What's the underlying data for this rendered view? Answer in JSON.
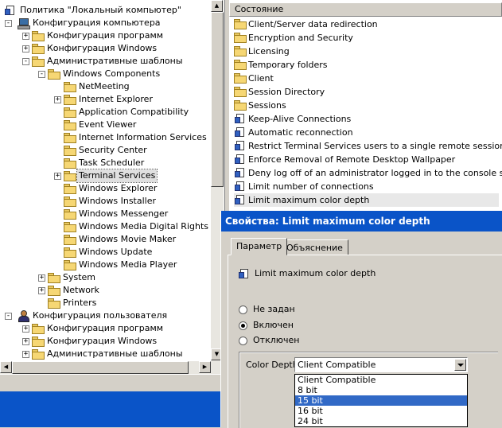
{
  "tree": {
    "items": [
      {
        "label": "Политика \"Локальный компьютер\"",
        "level": 0,
        "expander": "",
        "icon": "policy"
      },
      {
        "label": "Конфигурация компьютера",
        "level": 0,
        "expander": "−",
        "icon": "computer"
      },
      {
        "label": "Конфигурация программ",
        "level": 1,
        "expander": "+",
        "icon": "folder"
      },
      {
        "label": "Конфигурация Windows",
        "level": 1,
        "expander": "+",
        "icon": "folder"
      },
      {
        "label": "Административные шаблоны",
        "level": 1,
        "expander": "−",
        "icon": "folder"
      },
      {
        "label": "Windows Components",
        "level": 2,
        "expander": "−",
        "icon": "folder"
      },
      {
        "label": "NetMeeting",
        "level": 3,
        "expander": "",
        "icon": "folder"
      },
      {
        "label": "Internet Explorer",
        "level": 3,
        "expander": "+",
        "icon": "folder"
      },
      {
        "label": "Application Compatibility",
        "level": 3,
        "expander": "",
        "icon": "folder"
      },
      {
        "label": "Event Viewer",
        "level": 3,
        "expander": "",
        "icon": "folder"
      },
      {
        "label": "Internet Information Services",
        "level": 3,
        "expander": "",
        "icon": "folder"
      },
      {
        "label": "Security Center",
        "level": 3,
        "expander": "",
        "icon": "folder"
      },
      {
        "label": "Task Scheduler",
        "level": 3,
        "expander": "",
        "icon": "folder"
      },
      {
        "label": "Terminal Services",
        "level": 3,
        "expander": "+",
        "icon": "folder",
        "selected": true
      },
      {
        "label": "Windows Explorer",
        "level": 3,
        "expander": "",
        "icon": "folder"
      },
      {
        "label": "Windows Installer",
        "level": 3,
        "expander": "",
        "icon": "folder"
      },
      {
        "label": "Windows Messenger",
        "level": 3,
        "expander": "",
        "icon": "folder"
      },
      {
        "label": "Windows Media Digital Rights Mana",
        "level": 3,
        "expander": "",
        "icon": "folder"
      },
      {
        "label": "Windows Movie Maker",
        "level": 3,
        "expander": "",
        "icon": "folder"
      },
      {
        "label": "Windows Update",
        "level": 3,
        "expander": "",
        "icon": "folder"
      },
      {
        "label": "Windows Media Player",
        "level": 3,
        "expander": "",
        "icon": "folder"
      },
      {
        "label": "System",
        "level": 2,
        "expander": "+",
        "icon": "folder"
      },
      {
        "label": "Network",
        "level": 2,
        "expander": "+",
        "icon": "folder"
      },
      {
        "label": "Printers",
        "level": 2,
        "expander": "",
        "icon": "folder"
      },
      {
        "label": "Конфигурация пользователя",
        "level": 0,
        "expander": "−",
        "icon": "user"
      },
      {
        "label": "Конфигурация программ",
        "level": 1,
        "expander": "+",
        "icon": "folder"
      },
      {
        "label": "Конфигурация Windows",
        "level": 1,
        "expander": "+",
        "icon": "folder"
      },
      {
        "label": "Административные шаблоны",
        "level": 1,
        "expander": "+",
        "icon": "folder"
      }
    ]
  },
  "list": {
    "header": "Состояние",
    "items": [
      {
        "label": "Client/Server data redirection",
        "icon": "folder"
      },
      {
        "label": "Encryption and Security",
        "icon": "folder"
      },
      {
        "label": "Licensing",
        "icon": "folder"
      },
      {
        "label": "Temporary folders",
        "icon": "folder"
      },
      {
        "label": "Client",
        "icon": "folder"
      },
      {
        "label": "Session Directory",
        "icon": "folder"
      },
      {
        "label": "Sessions",
        "icon": "folder"
      },
      {
        "label": "Keep-Alive Connections",
        "icon": "policy"
      },
      {
        "label": "Automatic reconnection",
        "icon": "policy"
      },
      {
        "label": "Restrict Terminal Services users to a single remote session",
        "icon": "policy"
      },
      {
        "label": "Enforce Removal of Remote Desktop Wallpaper",
        "icon": "policy"
      },
      {
        "label": "Deny log off of an administrator logged in to the console session",
        "icon": "policy"
      },
      {
        "label": "Limit number of connections",
        "icon": "policy"
      },
      {
        "label": "Limit maximum color depth",
        "icon": "policy",
        "selected": true
      }
    ]
  },
  "dialog": {
    "title": "Свойства: Limit maximum color depth",
    "tabs": [
      "Параметр",
      "Объяснение"
    ],
    "setting_name": "Limit maximum color depth",
    "radios": [
      {
        "label": "Не задан",
        "checked": false
      },
      {
        "label": "Включен",
        "checked": true
      },
      {
        "label": "Отключен",
        "checked": false
      }
    ],
    "color_depth_label": "Color Depth",
    "color_depth_value": "Client Compatible",
    "options": [
      "Client Compatible",
      "8 bit",
      "15 bit",
      "16 bit",
      "24 bit"
    ],
    "highlighted_option": "15 bit"
  },
  "colors": {
    "titlebar": "#0a54c8",
    "selection": "#3169c6",
    "face": "#d4d0c8"
  }
}
